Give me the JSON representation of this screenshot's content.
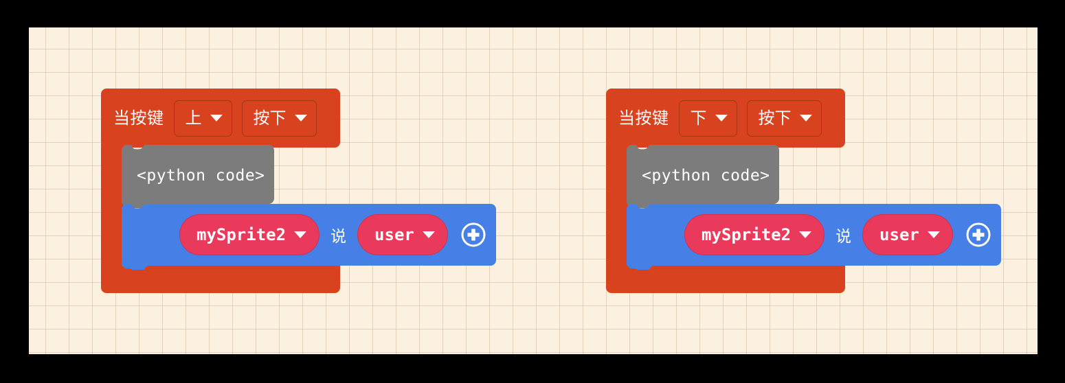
{
  "workspace": {
    "background_color": "#FCF1E1",
    "grid_color": "#CBB9A0",
    "grid_size": 34
  },
  "colors": {
    "event_red": "#D8421F",
    "event_red_dark": "#B8341A",
    "python_gray": "#7C7C7C",
    "python_gray_dark": "#6A6A6A",
    "say_blue": "#4680E6",
    "say_blue_dark": "#3668C8",
    "field_pink": "#EA3A5B",
    "text_white": "#FFFFFF"
  },
  "scripts": [
    {
      "id": "script-1",
      "hat": {
        "label": "当按键",
        "fields": [
          {
            "name": "key",
            "value": "上",
            "icon": "chevron-down-icon"
          },
          {
            "name": "event",
            "value": "按下",
            "icon": "chevron-down-icon"
          }
        ]
      },
      "body": [
        {
          "type": "python-code",
          "text": "<python code>"
        },
        {
          "type": "say",
          "sprite": {
            "name": "sprite-selector",
            "value": "mySprite2",
            "icon": "chevron-down-icon"
          },
          "verb": "说",
          "message": {
            "name": "message-selector",
            "value": "user",
            "icon": "chevron-down-icon"
          },
          "add_icon": "plus-circle-icon"
        }
      ]
    },
    {
      "id": "script-2",
      "hat": {
        "label": "当按键",
        "fields": [
          {
            "name": "key",
            "value": "下",
            "icon": "chevron-down-icon"
          },
          {
            "name": "event",
            "value": "按下",
            "icon": "chevron-down-icon"
          }
        ]
      },
      "body": [
        {
          "type": "python-code",
          "text": "<python code>"
        },
        {
          "type": "say",
          "sprite": {
            "name": "sprite-selector",
            "value": "mySprite2",
            "icon": "chevron-down-icon"
          },
          "verb": "说",
          "message": {
            "name": "message-selector",
            "value": "user",
            "icon": "chevron-down-icon"
          },
          "add_icon": "plus-circle-icon"
        }
      ]
    }
  ]
}
